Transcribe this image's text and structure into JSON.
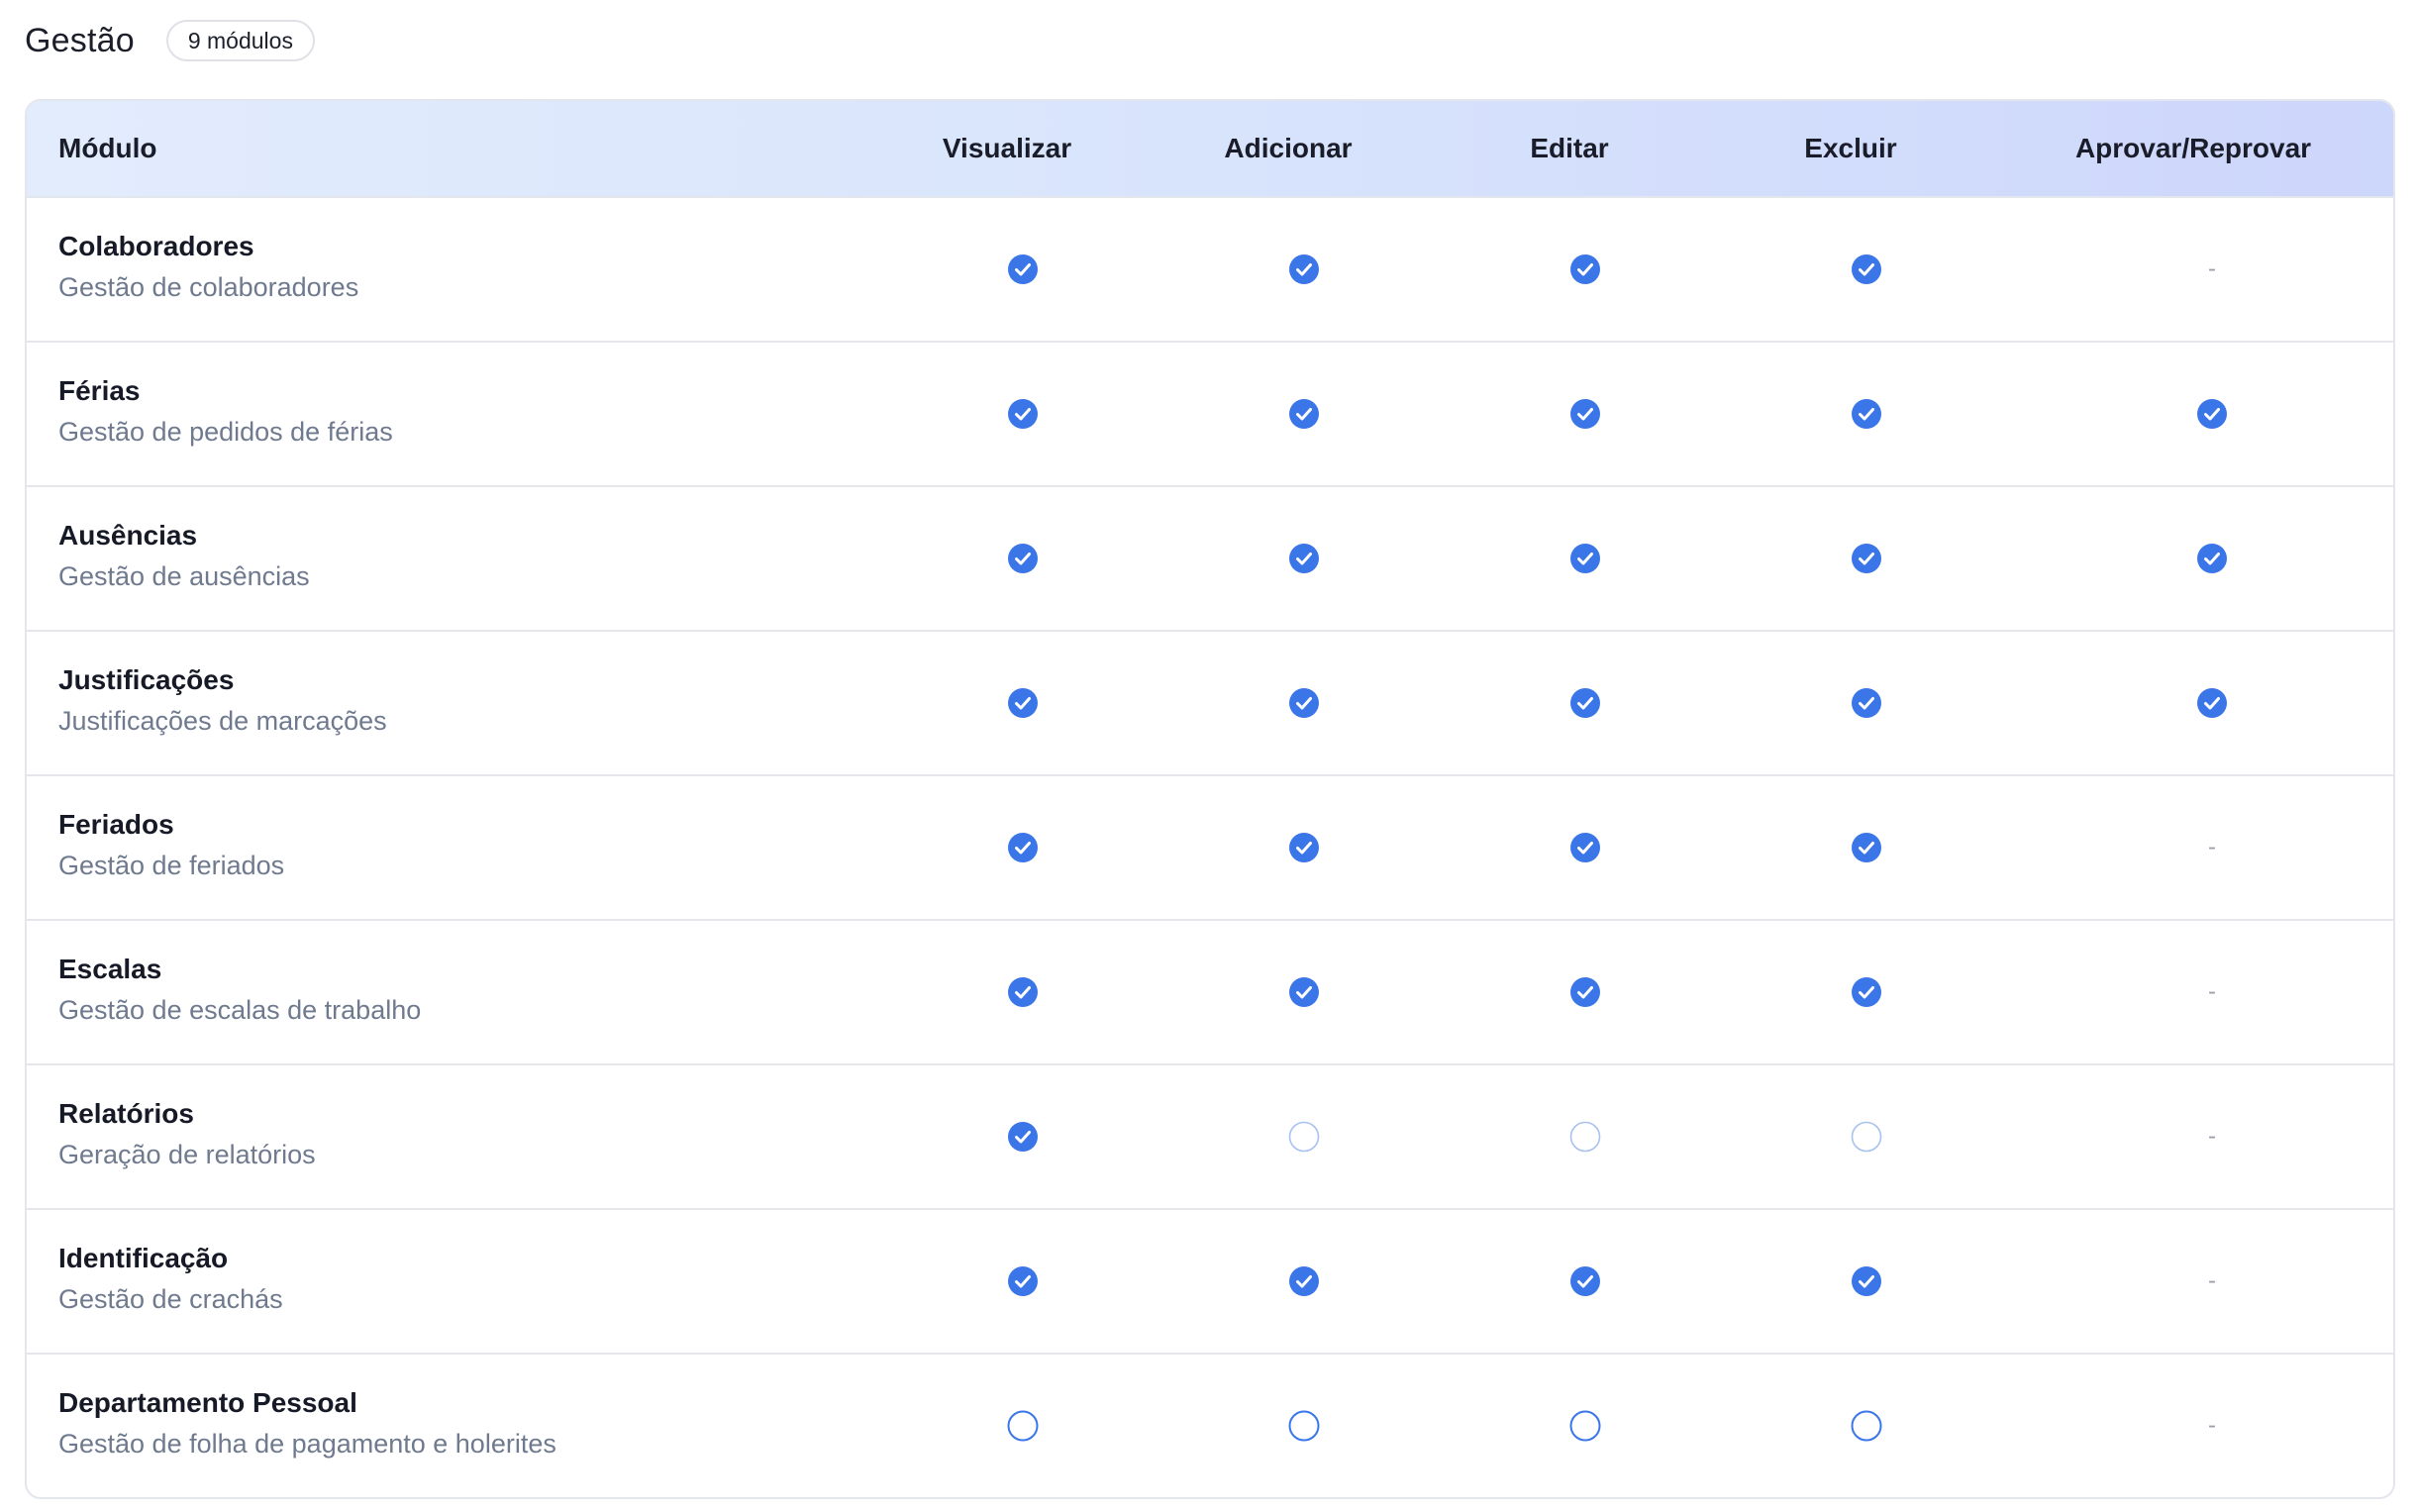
{
  "header": {
    "title": "Gestão",
    "badge": "9 módulos"
  },
  "table": {
    "columns": {
      "module": "Módulo",
      "view": "Visualizar",
      "add": "Adicionar",
      "edit": "Editar",
      "delete": "Excluir",
      "approve": "Aprovar/Reprovar"
    },
    "rows": [
      {
        "name": "Colaboradores",
        "description": "Gestão de colaboradores",
        "view": "checked",
        "add": "checked",
        "edit": "checked",
        "delete": "checked",
        "approve": "-"
      },
      {
        "name": "Férias",
        "description": "Gestão de pedidos de férias",
        "view": "checked",
        "add": "checked",
        "edit": "checked",
        "delete": "checked",
        "approve": "checked"
      },
      {
        "name": "Ausências",
        "description": "Gestão de ausências",
        "view": "checked",
        "add": "checked",
        "edit": "checked",
        "delete": "checked",
        "approve": "checked"
      },
      {
        "name": "Justificações",
        "description": "Justificações de marcações",
        "view": "checked",
        "add": "checked",
        "edit": "checked",
        "delete": "checked",
        "approve": "checked"
      },
      {
        "name": "Feriados",
        "description": "Gestão de feriados",
        "view": "checked",
        "add": "checked",
        "edit": "checked",
        "delete": "checked",
        "approve": "-"
      },
      {
        "name": "Escalas",
        "description": "Gestão de escalas de trabalho",
        "view": "checked",
        "add": "checked",
        "edit": "checked",
        "delete": "checked",
        "approve": "-"
      },
      {
        "name": "Relatórios",
        "description": "Geração de relatórios",
        "view": "checked",
        "add": "disabled",
        "edit": "disabled",
        "delete": "disabled",
        "approve": "-"
      },
      {
        "name": "Identificação",
        "description": "Gestão de crachás",
        "view": "checked",
        "add": "checked",
        "edit": "checked",
        "delete": "checked",
        "approve": "-"
      },
      {
        "name": "Departamento Pessoal",
        "description": "Gestão de folha de pagamento e holerites",
        "view": "unchecked",
        "add": "unchecked",
        "edit": "unchecked",
        "delete": "unchecked",
        "approve": "-"
      }
    ]
  },
  "colors": {
    "accent": "#3b76e8",
    "disabled_outline": "#a9c2ef",
    "header_gradient_start": "#e3ecfd",
    "header_gradient_end": "#cdd6fb"
  },
  "icons": {
    "checked": "check-circle-icon",
    "unchecked": "empty-circle-icon",
    "disabled": "empty-circle-disabled-icon"
  }
}
